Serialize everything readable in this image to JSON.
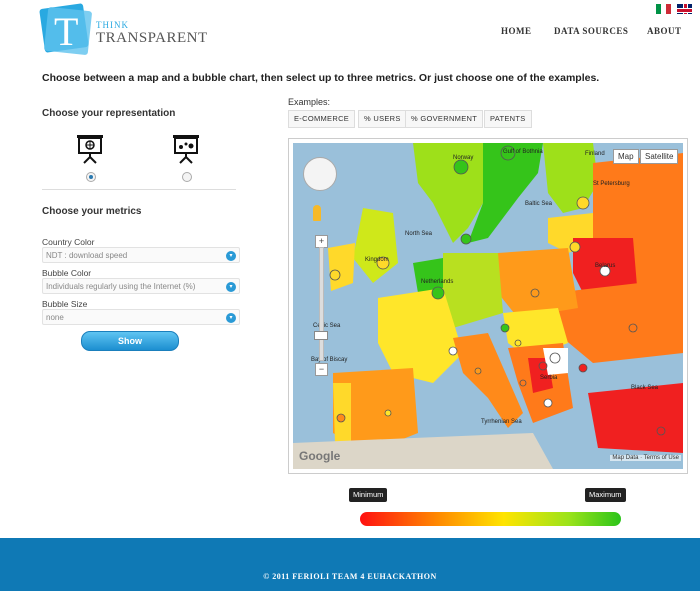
{
  "header": {
    "logo_letter": "T",
    "logo_think": "THINK",
    "logo_transparent": "TRANSPARENT",
    "nav": [
      "HOME",
      "DATA SOURCES",
      "ABOUT"
    ],
    "flags": [
      "italian-flag-icon",
      "uk-flag-icon"
    ]
  },
  "intro": "Choose between a map and a bubble chart, then select up to three metrics. Or just choose one of the examples.",
  "representation": {
    "title": "Choose your representation",
    "options": [
      {
        "name": "map",
        "icon": "map-presentation-icon",
        "selected": true
      },
      {
        "name": "bubble",
        "icon": "bubble-presentation-icon",
        "selected": false
      }
    ]
  },
  "metrics": {
    "title": "Choose your metrics",
    "country_color_label": "Country Color",
    "country_color_value": "NDT : download speed",
    "bubble_color_label": "Bubble Color",
    "bubble_color_value": "Individuals regularly using the Internet (%)",
    "bubble_size_label": "Bubble Size",
    "bubble_size_value": "none",
    "show_label": "Show"
  },
  "examples": {
    "label": "Examples:",
    "items": [
      "E-COMMERCE",
      "% USERS",
      "% GOVERNMENT",
      "PATENTS"
    ]
  },
  "map": {
    "type_map": "Map",
    "type_satellite": "Satellite",
    "google": "Google",
    "credit": "Map Data · Terms of Use",
    "labels": {
      "norway": "Norway",
      "gulf_bothnia": "Gulf of Bothnia",
      "finland": "Finland",
      "st_petersburg": "St Petersburg",
      "baltic_sea": "Baltic Sea",
      "north_sea": "North Sea",
      "kingdom": "Kingdom",
      "netherlands": "Netherlands",
      "belarus": "Belarus",
      "celtic_sea": "Celtic Sea",
      "bay_biscay": "Bay of Biscay",
      "serbia": "Serbia",
      "black_sea": "Black Sea",
      "tyrrhenian": "Tyrrhenian Sea"
    }
  },
  "legend": {
    "min": "Minimum",
    "max": "Maximum"
  },
  "footer": "© 2011 FERIOLI TEAM 4 EUHACKATHON",
  "colors": {
    "accent": "#29a9e1",
    "footer": "#0f79b5",
    "low": "#ff1010",
    "high": "#2bc41a"
  }
}
